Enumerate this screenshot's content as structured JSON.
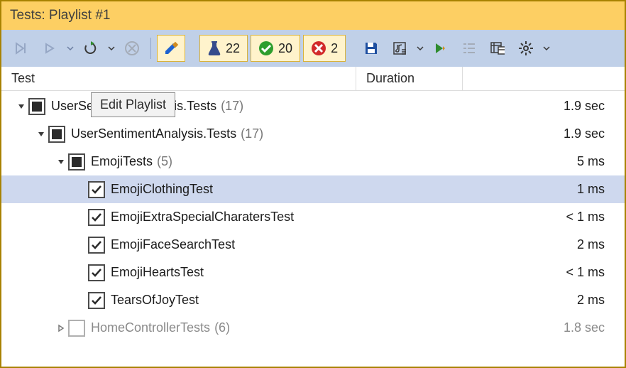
{
  "title": "Tests: Playlist #1",
  "tooltip": "Edit Playlist",
  "columns": {
    "test": "Test",
    "duration": "Duration"
  },
  "counts": {
    "total": "22",
    "passed": "20",
    "failed": "2"
  },
  "tree": [
    {
      "indent": 0,
      "expander": "down",
      "check": "mixed",
      "label": "UserSentimentAnalysis.Tests",
      "count": "(17)",
      "duration": "1.9 sec",
      "dim": false
    },
    {
      "indent": 1,
      "expander": "down",
      "check": "mixed",
      "label": "UserSentimentAnalysis.Tests",
      "count": "(17)",
      "duration": "1.9 sec",
      "dim": false
    },
    {
      "indent": 2,
      "expander": "down",
      "check": "mixed",
      "label": "EmojiTests",
      "count": "(5)",
      "duration": "5 ms",
      "dim": false
    },
    {
      "indent": 3,
      "expander": "none",
      "check": "checked",
      "label": "EmojiClothingTest",
      "count": "",
      "duration": "1 ms",
      "dim": false,
      "selected": true
    },
    {
      "indent": 3,
      "expander": "none",
      "check": "checked",
      "label": "EmojiExtraSpecialCharatersTest",
      "count": "",
      "duration": "< 1 ms",
      "dim": false
    },
    {
      "indent": 3,
      "expander": "none",
      "check": "checked",
      "label": "EmojiFaceSearchTest",
      "count": "",
      "duration": "2 ms",
      "dim": false
    },
    {
      "indent": 3,
      "expander": "none",
      "check": "checked",
      "label": "EmojiHeartsTest",
      "count": "",
      "duration": "< 1 ms",
      "dim": false
    },
    {
      "indent": 3,
      "expander": "none",
      "check": "checked",
      "label": "TearsOfJoyTest",
      "count": "",
      "duration": "2 ms",
      "dim": false
    },
    {
      "indent": 2,
      "expander": "right",
      "check": "unchecked",
      "label": "HomeControllerTests",
      "count": "(6)",
      "duration": "1.8 sec",
      "dim": true
    }
  ]
}
